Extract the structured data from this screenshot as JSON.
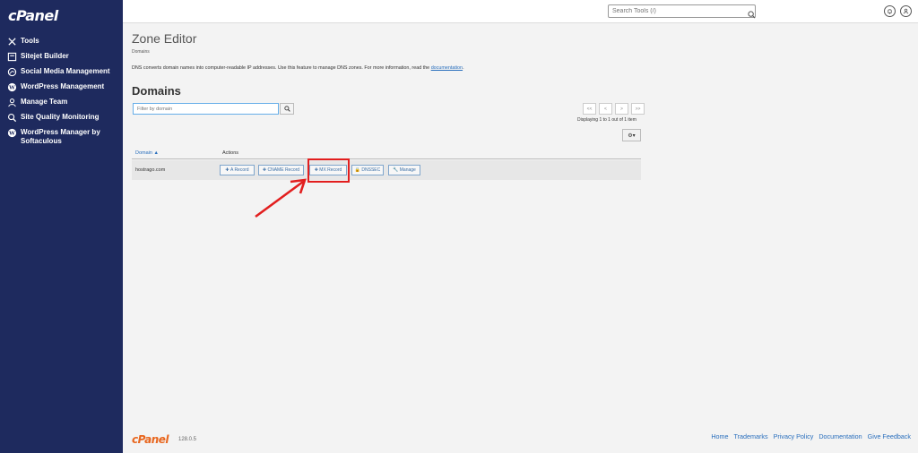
{
  "sidebar": {
    "logo": "cPanel",
    "items": [
      {
        "label": "Tools",
        "icon": "tools-icon"
      },
      {
        "label": "Sitejet Builder",
        "icon": "sitejet-icon"
      },
      {
        "label": "Social Media Management",
        "icon": "social-media-icon"
      },
      {
        "label": "WordPress Management",
        "icon": "wordpress-icon"
      },
      {
        "label": "Manage Team",
        "icon": "team-icon"
      },
      {
        "label": "Site Quality Monitoring",
        "icon": "quality-search-icon"
      },
      {
        "label": "WordPress Manager by Softaculous",
        "icon": "wordpress-icon"
      }
    ]
  },
  "topbar": {
    "search_placeholder": "Search Tools (/)"
  },
  "page": {
    "title": "Zone Editor",
    "breadcrumb": "Domains",
    "description": "DNS converts domain names into computer-readable IP addresses. Use this feature to manage DNS zones. For more information, read the ",
    "doc_link": "documentation",
    "desc_end": ".",
    "section_title": "Domains",
    "filter_placeholder": "Filter by domain"
  },
  "pager": {
    "buttons": [
      "<<",
      "<",
      ">",
      ">>"
    ],
    "displaying": "Displaying 1 to 1 out of 1 item"
  },
  "table": {
    "col_domain": "Domain",
    "col_actions": "Actions",
    "rows": [
      {
        "domain": "hostrago.com",
        "actions": [
          "A Record",
          "CNAME Record",
          "MX Record",
          "DNSSEC",
          "Manage"
        ]
      }
    ]
  },
  "footer": {
    "logo": "cPanel",
    "version": "128.0.5",
    "links": [
      "Home",
      "Trademarks",
      "Privacy Policy",
      "Documentation",
      "Give Feedback"
    ]
  },
  "colors": {
    "sidebar": "#1e2a5e",
    "accent": "#2a6fbd",
    "highlight": "#e21e1e",
    "brand_orange": "#e8661e"
  }
}
